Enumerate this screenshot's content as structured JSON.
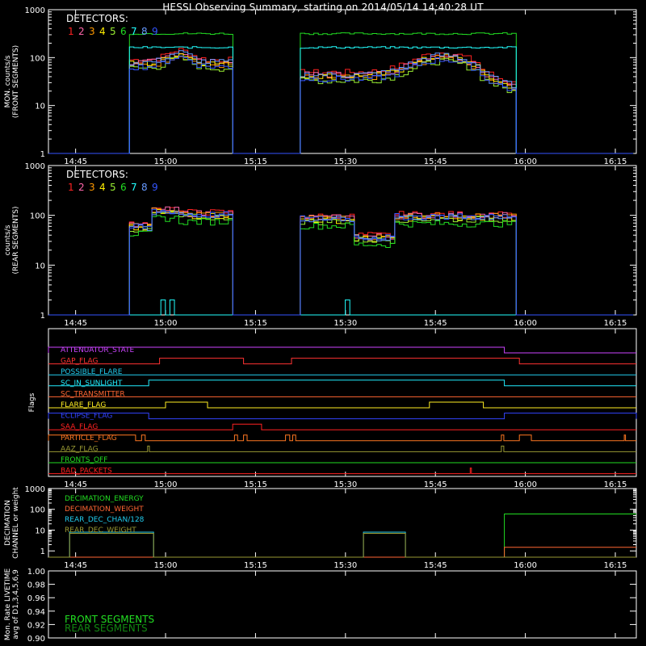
{
  "title": "HESSI Observing Summary, starting on 2014/05/14 14:40:28 UT",
  "colors": {
    "det": [
      "#ff2222",
      "#ff66aa",
      "#ff9900",
      "#ffee00",
      "#99ee33",
      "#22dd22",
      "#22ffff",
      "#6699ff",
      "#3355ff"
    ],
    "axis": "#ffffff"
  },
  "chart_data": [
    {
      "id": "front",
      "type": "line",
      "ylabel": [
        "MON. counts/s",
        "(FRONT SEGMENTS)"
      ],
      "yscale": "log",
      "ylim": [
        1,
        1000
      ],
      "ytick_labels": [
        "1",
        "10",
        "100",
        "1000"
      ],
      "xlim_minutes": [
        40.47,
        138.5
      ],
      "x_tick_labels": [
        "14:45",
        "15:00",
        "15:15",
        "15:30",
        "15:45",
        "16:00",
        "16:15"
      ],
      "legend_title": "DETECTORS:",
      "legend_items": [
        "1",
        "2",
        "3",
        "4",
        "5",
        "6",
        "7",
        "8",
        "9"
      ],
      "series": [
        {
          "name": "1",
          "level": 90,
          "scale": 0.9
        },
        {
          "name": "2",
          "level": 80,
          "scale": 0.85
        },
        {
          "name": "3",
          "level": 70,
          "scale": 0.8
        },
        {
          "name": "4",
          "level": 75,
          "scale": 0.8
        },
        {
          "name": "5",
          "level": 60,
          "scale": 0.7
        },
        {
          "name": "6",
          "level": 330,
          "scale": 1.0
        },
        {
          "name": "7",
          "level": 170,
          "scale": 1.0
        },
        {
          "name": "8",
          "level": 80,
          "scale": 0.85
        },
        {
          "name": "9",
          "level": 65,
          "scale": 0.75
        }
      ]
    },
    {
      "id": "rear",
      "type": "line",
      "ylabel": [
        "counts/s",
        "(REAR SEGMENTS)"
      ],
      "yscale": "log",
      "ylim": [
        1,
        1000
      ],
      "ytick_labels": [
        "1",
        "10",
        "100",
        "1000"
      ],
      "xlim_minutes": [
        40.47,
        138.5
      ],
      "x_tick_labels": [
        "14:45",
        "15:00",
        "15:15",
        "15:30",
        "15:45",
        "16:00",
        "16:15"
      ],
      "legend_title": "DETECTORS:",
      "legend_items": [
        "1",
        "2",
        "3",
        "4",
        "5",
        "6",
        "7",
        "8",
        "9"
      ],
      "series": [
        {
          "name": "1",
          "level": 100
        },
        {
          "name": "2",
          "level": 95
        },
        {
          "name": "3",
          "level": 92
        },
        {
          "name": "4",
          "level": 85
        },
        {
          "name": "5",
          "level": 80
        },
        {
          "name": "6",
          "level": 65
        },
        {
          "name": "7",
          "level": 1
        },
        {
          "name": "8",
          "level": 88
        },
        {
          "name": "9",
          "level": 90
        }
      ]
    },
    {
      "id": "flags",
      "type": "line",
      "ylabel": [
        "Flags"
      ],
      "xlim_minutes": [
        40.47,
        138.5
      ],
      "x_tick_labels": [
        "14:45",
        "15:00",
        "15:15",
        "15:30",
        "15:45",
        "16:00",
        "16:15"
      ],
      "flags": [
        {
          "name": "ATTENUATOR_STATE",
          "color": "#cc44ff",
          "on": [
            [
              40.47,
              116.5
            ]
          ]
        },
        {
          "name": "GAP_FLAG",
          "color": "#ff3333",
          "on": [
            [
              59,
              73
            ],
            [
              81,
              119
            ]
          ]
        },
        {
          "name": "POSSIBLE_FLARE",
          "color": "#22ccee",
          "on": []
        },
        {
          "name": "SC_IN_SUNLIGHT",
          "color": "#22eeff",
          "on": [
            [
              57.2,
              116.5
            ]
          ]
        },
        {
          "name": "SC_TRANSMITTER",
          "color": "#ff6633",
          "on": []
        },
        {
          "name": "FLARE_FLAG",
          "color": "#ffee22",
          "on": [
            [
              60,
              67
            ],
            [
              104,
              113
            ]
          ]
        },
        {
          "name": "ECLIPSE_FLAG",
          "color": "#3344ff",
          "on": [
            [
              40.47,
              57.2
            ],
            [
              116.5,
              138.5
            ]
          ]
        },
        {
          "name": "SAA_FLAG",
          "color": "#ff2222",
          "on": [
            [
              71.2,
              76
            ]
          ]
        },
        {
          "name": "PARTICLE_FLAG",
          "color": "#ff7722",
          "on": [
            [
              40.47,
              55
            ],
            [
              56,
              56.6
            ],
            [
              71.5,
              72
            ],
            [
              73,
              73.6
            ],
            [
              80,
              80.7
            ],
            [
              81.2,
              81.7
            ],
            [
              116,
              116.4
            ],
            [
              119,
              121
            ],
            [
              136.5,
              136.7
            ]
          ]
        },
        {
          "name": "AAZ_FLAG",
          "color": "#999933",
          "on": [
            [
              57,
              57.3
            ],
            [
              116,
              116.4
            ]
          ]
        },
        {
          "name": "FRONTS_OFF",
          "color": "#22dd22",
          "on": []
        },
        {
          "name": "BAD_PACKETS",
          "color": "#ff2222",
          "on": [
            [
              110.8,
              111
            ]
          ]
        }
      ]
    },
    {
      "id": "decimation",
      "type": "line",
      "ylabel": [
        "DECIMATION",
        "CHANNEL or weight"
      ],
      "yscale": "log",
      "ylim": [
        0.5,
        1000
      ],
      "ytick_labels": [
        "1",
        "10",
        "100",
        "1000"
      ],
      "xlim_minutes": [
        40.47,
        138.5
      ],
      "x_tick_labels": [
        "14:45",
        "15:00",
        "15:15",
        "15:30",
        "15:45",
        "16:00",
        "16:15"
      ],
      "legend_items": [
        "DECIMATION_ENERGY",
        "DECIMATION_WEIGHT",
        "REAR_DEC_CHAN/128",
        "REAR_DEC_WEIGHT"
      ],
      "legend_colors": [
        "#22dd22",
        "#ff6633",
        "#22ccee",
        "#999933"
      ],
      "series": [
        {
          "name": "DECIMATION_ENERGY",
          "steps": [
            [
              40.47,
              0.5
            ],
            [
              116.5,
              60
            ],
            [
              138.5,
              60
            ]
          ]
        },
        {
          "name": "DECIMATION_WEIGHT",
          "steps": [
            [
              40.47,
              0.5
            ],
            [
              116.5,
              1.5
            ],
            [
              137.5,
              1.5
            ],
            [
              138.5,
              1.5
            ]
          ]
        },
        {
          "name": "REAR_DEC_CHAN/128",
          "steps": [
            [
              40.47,
              0.5
            ],
            [
              44,
              8
            ],
            [
              58,
              0.5
            ],
            [
              93,
              8
            ],
            [
              100,
              0.5
            ],
            [
              138.5,
              0.5
            ]
          ]
        },
        {
          "name": "REAR_DEC_WEIGHT",
          "steps": [
            [
              40.47,
              0.5
            ],
            [
              44,
              7
            ],
            [
              58,
              0.5
            ],
            [
              93,
              7
            ],
            [
              100,
              0.5
            ],
            [
              138.5,
              0.5
            ]
          ]
        }
      ]
    },
    {
      "id": "livetime",
      "type": "line",
      "ylabel": [
        "Mon. Rate LIVETIME",
        "avg of D1,3,4,5,6,9"
      ],
      "ylim": [
        0.9,
        1.0
      ],
      "ytick_labels": [
        "0.90",
        "0.92",
        "0.94",
        "0.96",
        "0.98",
        "1.00"
      ],
      "xlim_minutes": [
        40.47,
        138.5
      ],
      "legend_items": [
        "FRONT SEGMENTS",
        "REAR SEGMENTS"
      ],
      "legend_colors": [
        "#22dd22",
        "#118811"
      ]
    }
  ]
}
